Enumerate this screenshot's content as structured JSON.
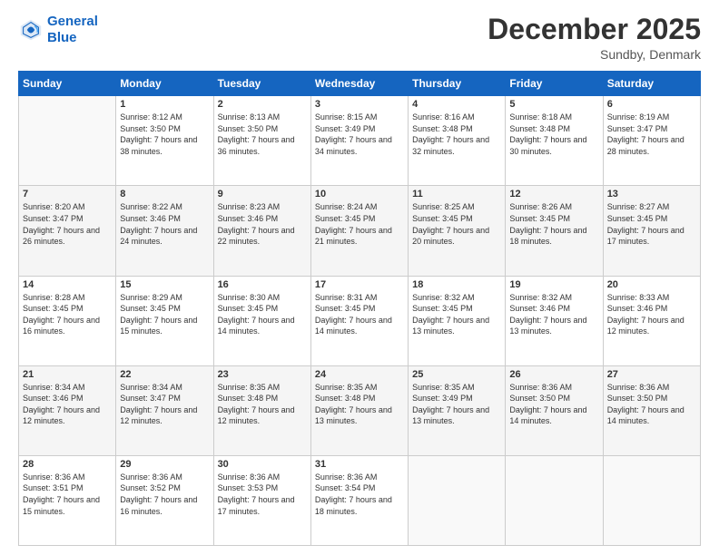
{
  "header": {
    "logo_line1": "General",
    "logo_line2": "Blue",
    "title": "December 2025",
    "subtitle": "Sundby, Denmark"
  },
  "calendar": {
    "headers": [
      "Sunday",
      "Monday",
      "Tuesday",
      "Wednesday",
      "Thursday",
      "Friday",
      "Saturday"
    ],
    "weeks": [
      [
        {
          "date": "",
          "sunrise": "",
          "sunset": "",
          "daylight": ""
        },
        {
          "date": "1",
          "sunrise": "Sunrise: 8:12 AM",
          "sunset": "Sunset: 3:50 PM",
          "daylight": "Daylight: 7 hours and 38 minutes."
        },
        {
          "date": "2",
          "sunrise": "Sunrise: 8:13 AM",
          "sunset": "Sunset: 3:50 PM",
          "daylight": "Daylight: 7 hours and 36 minutes."
        },
        {
          "date": "3",
          "sunrise": "Sunrise: 8:15 AM",
          "sunset": "Sunset: 3:49 PM",
          "daylight": "Daylight: 7 hours and 34 minutes."
        },
        {
          "date": "4",
          "sunrise": "Sunrise: 8:16 AM",
          "sunset": "Sunset: 3:48 PM",
          "daylight": "Daylight: 7 hours and 32 minutes."
        },
        {
          "date": "5",
          "sunrise": "Sunrise: 8:18 AM",
          "sunset": "Sunset: 3:48 PM",
          "daylight": "Daylight: 7 hours and 30 minutes."
        },
        {
          "date": "6",
          "sunrise": "Sunrise: 8:19 AM",
          "sunset": "Sunset: 3:47 PM",
          "daylight": "Daylight: 7 hours and 28 minutes."
        }
      ],
      [
        {
          "date": "7",
          "sunrise": "Sunrise: 8:20 AM",
          "sunset": "Sunset: 3:47 PM",
          "daylight": "Daylight: 7 hours and 26 minutes."
        },
        {
          "date": "8",
          "sunrise": "Sunrise: 8:22 AM",
          "sunset": "Sunset: 3:46 PM",
          "daylight": "Daylight: 7 hours and 24 minutes."
        },
        {
          "date": "9",
          "sunrise": "Sunrise: 8:23 AM",
          "sunset": "Sunset: 3:46 PM",
          "daylight": "Daylight: 7 hours and 22 minutes."
        },
        {
          "date": "10",
          "sunrise": "Sunrise: 8:24 AM",
          "sunset": "Sunset: 3:45 PM",
          "daylight": "Daylight: 7 hours and 21 minutes."
        },
        {
          "date": "11",
          "sunrise": "Sunrise: 8:25 AM",
          "sunset": "Sunset: 3:45 PM",
          "daylight": "Daylight: 7 hours and 20 minutes."
        },
        {
          "date": "12",
          "sunrise": "Sunrise: 8:26 AM",
          "sunset": "Sunset: 3:45 PM",
          "daylight": "Daylight: 7 hours and 18 minutes."
        },
        {
          "date": "13",
          "sunrise": "Sunrise: 8:27 AM",
          "sunset": "Sunset: 3:45 PM",
          "daylight": "Daylight: 7 hours and 17 minutes."
        }
      ],
      [
        {
          "date": "14",
          "sunrise": "Sunrise: 8:28 AM",
          "sunset": "Sunset: 3:45 PM",
          "daylight": "Daylight: 7 hours and 16 minutes."
        },
        {
          "date": "15",
          "sunrise": "Sunrise: 8:29 AM",
          "sunset": "Sunset: 3:45 PM",
          "daylight": "Daylight: 7 hours and 15 minutes."
        },
        {
          "date": "16",
          "sunrise": "Sunrise: 8:30 AM",
          "sunset": "Sunset: 3:45 PM",
          "daylight": "Daylight: 7 hours and 14 minutes."
        },
        {
          "date": "17",
          "sunrise": "Sunrise: 8:31 AM",
          "sunset": "Sunset: 3:45 PM",
          "daylight": "Daylight: 7 hours and 14 minutes."
        },
        {
          "date": "18",
          "sunrise": "Sunrise: 8:32 AM",
          "sunset": "Sunset: 3:45 PM",
          "daylight": "Daylight: 7 hours and 13 minutes."
        },
        {
          "date": "19",
          "sunrise": "Sunrise: 8:32 AM",
          "sunset": "Sunset: 3:46 PM",
          "daylight": "Daylight: 7 hours and 13 minutes."
        },
        {
          "date": "20",
          "sunrise": "Sunrise: 8:33 AM",
          "sunset": "Sunset: 3:46 PM",
          "daylight": "Daylight: 7 hours and 12 minutes."
        }
      ],
      [
        {
          "date": "21",
          "sunrise": "Sunrise: 8:34 AM",
          "sunset": "Sunset: 3:46 PM",
          "daylight": "Daylight: 7 hours and 12 minutes."
        },
        {
          "date": "22",
          "sunrise": "Sunrise: 8:34 AM",
          "sunset": "Sunset: 3:47 PM",
          "daylight": "Daylight: 7 hours and 12 minutes."
        },
        {
          "date": "23",
          "sunrise": "Sunrise: 8:35 AM",
          "sunset": "Sunset: 3:48 PM",
          "daylight": "Daylight: 7 hours and 12 minutes."
        },
        {
          "date": "24",
          "sunrise": "Sunrise: 8:35 AM",
          "sunset": "Sunset: 3:48 PM",
          "daylight": "Daylight: 7 hours and 13 minutes."
        },
        {
          "date": "25",
          "sunrise": "Sunrise: 8:35 AM",
          "sunset": "Sunset: 3:49 PM",
          "daylight": "Daylight: 7 hours and 13 minutes."
        },
        {
          "date": "26",
          "sunrise": "Sunrise: 8:36 AM",
          "sunset": "Sunset: 3:50 PM",
          "daylight": "Daylight: 7 hours and 14 minutes."
        },
        {
          "date": "27",
          "sunrise": "Sunrise: 8:36 AM",
          "sunset": "Sunset: 3:50 PM",
          "daylight": "Daylight: 7 hours and 14 minutes."
        }
      ],
      [
        {
          "date": "28",
          "sunrise": "Sunrise: 8:36 AM",
          "sunset": "Sunset: 3:51 PM",
          "daylight": "Daylight: 7 hours and 15 minutes."
        },
        {
          "date": "29",
          "sunrise": "Sunrise: 8:36 AM",
          "sunset": "Sunset: 3:52 PM",
          "daylight": "Daylight: 7 hours and 16 minutes."
        },
        {
          "date": "30",
          "sunrise": "Sunrise: 8:36 AM",
          "sunset": "Sunset: 3:53 PM",
          "daylight": "Daylight: 7 hours and 17 minutes."
        },
        {
          "date": "31",
          "sunrise": "Sunrise: 8:36 AM",
          "sunset": "Sunset: 3:54 PM",
          "daylight": "Daylight: 7 hours and 18 minutes."
        },
        {
          "date": "",
          "sunrise": "",
          "sunset": "",
          "daylight": ""
        },
        {
          "date": "",
          "sunrise": "",
          "sunset": "",
          "daylight": ""
        },
        {
          "date": "",
          "sunrise": "",
          "sunset": "",
          "daylight": ""
        }
      ]
    ]
  }
}
